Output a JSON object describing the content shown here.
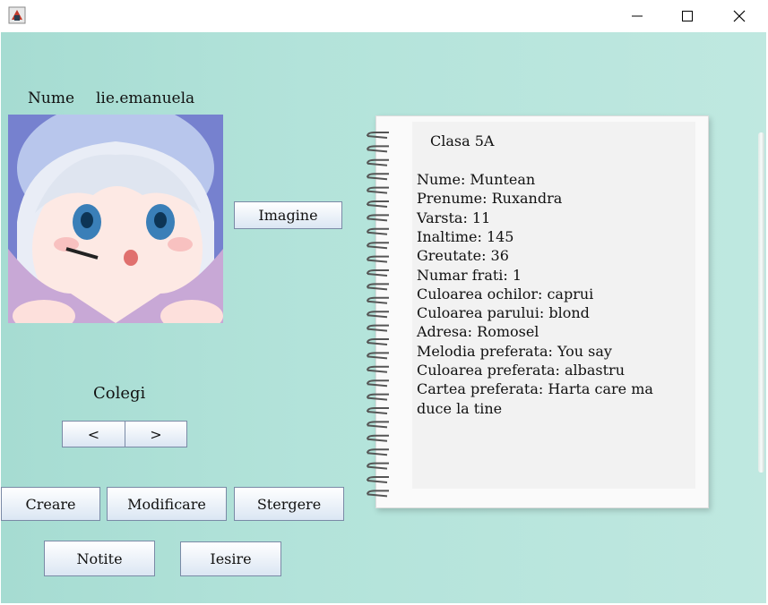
{
  "window": {
    "icon": "java-app-icon",
    "controls": [
      "minimize-icon",
      "maximize-icon",
      "close-icon"
    ]
  },
  "profile": {
    "name_label": "Nume",
    "name_value": "lie.emanuela",
    "image_button": "Imagine"
  },
  "colleagues": {
    "title": "Colegi",
    "prev_label": "<",
    "next_label": ">"
  },
  "actions": {
    "create": "Creare",
    "modify": "Modificare",
    "delete": "Stergere",
    "notes": "Notite",
    "exit": "Iesire"
  },
  "notebook": {
    "class_line": "Clasa 5A",
    "lines": [
      "Nume: Muntean",
      "Prenume: Ruxandra",
      "Varsta: 11",
      "Inaltime: 145",
      "Greutate: 36",
      "Numar frati: 1",
      "Culoarea ochilor: caprui",
      "Culoarea parului: blond",
      "Adresa: Romosel",
      "Melodia preferata: You say",
      "Culoarea preferata: albastru",
      "Cartea preferata: Harta care ma",
      "duce la tine"
    ]
  }
}
